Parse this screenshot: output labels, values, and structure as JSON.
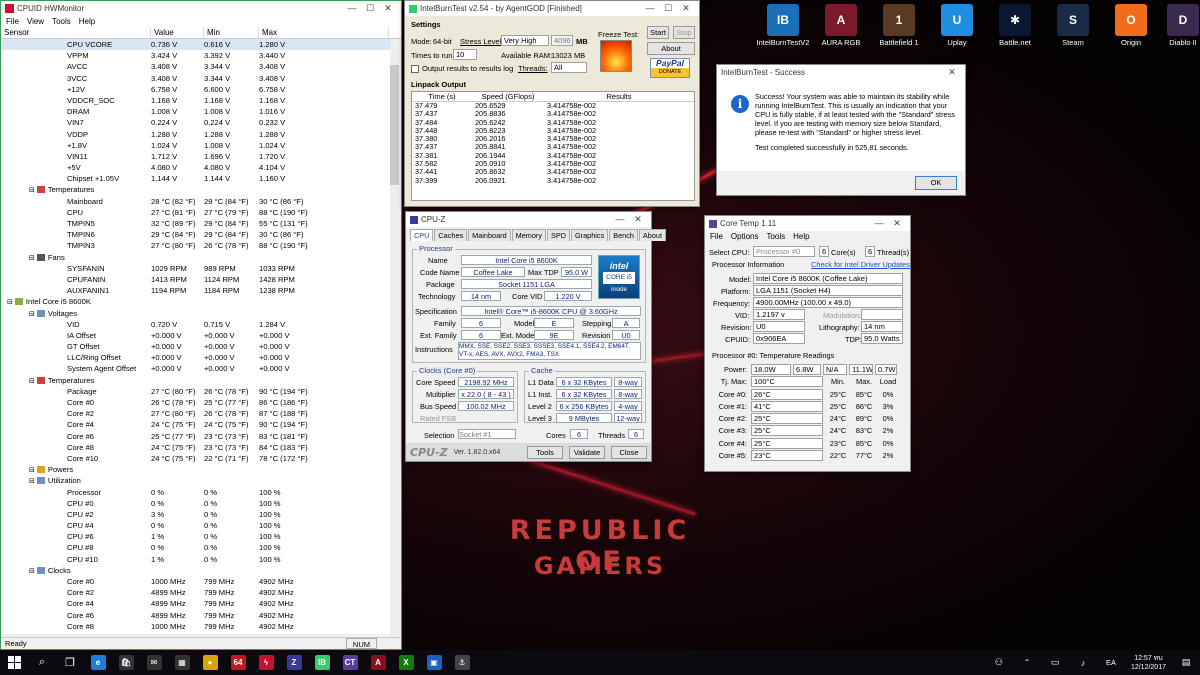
{
  "desktop": {
    "brand_line1": "REPUBLIC OF",
    "brand_line2": "GAMERS",
    "icons": [
      {
        "label": "IntelBurnTestV2",
        "icon": "intelburntest-icon",
        "color": "#1b6fb8",
        "glyph": "IB"
      },
      {
        "label": "AURA RGB",
        "icon": "aura-rgb-icon",
        "color": "#7a1a2a",
        "glyph": "A"
      },
      {
        "label": "Battlefield 1",
        "icon": "battlefield-icon",
        "color": "#5a3a22",
        "glyph": "1"
      },
      {
        "label": "Uplay",
        "icon": "uplay-icon",
        "color": "#1e8fe0",
        "glyph": "U"
      },
      {
        "label": "Battle.net",
        "icon": "battlenet-icon",
        "color": "#0b1730",
        "glyph": "✱"
      },
      {
        "label": "Steam",
        "icon": "steam-icon",
        "color": "#1a2b45",
        "glyph": "S"
      },
      {
        "label": "Origin",
        "icon": "origin-icon",
        "color": "#f26a1b",
        "glyph": "O"
      },
      {
        "label": "Diablo II",
        "icon": "diablo-icon",
        "color": "#3a2a50",
        "glyph": "D"
      }
    ]
  },
  "hwmon": {
    "title": "CPUID HWMonitor",
    "menu": [
      "File",
      "View",
      "Tools",
      "Help"
    ],
    "columns": [
      "Sensor",
      "Value",
      "Min",
      "Max"
    ],
    "status": "Ready",
    "num": "NUM",
    "rows": [
      [
        "CPU VCORE",
        "0.736 V",
        "0.616 V",
        "1.280 V",
        3,
        "volt"
      ],
      [
        "VPPM",
        "3.424 V",
        "3.392 V",
        "3.440 V",
        3,
        "volt"
      ],
      [
        "AVCC",
        "3.408 V",
        "3.344 V",
        "3.408 V",
        3,
        "volt"
      ],
      [
        "3VCC",
        "3.408 V",
        "3.344 V",
        "3.408 V",
        3,
        "volt"
      ],
      [
        "+12V",
        "6.758 V",
        "6.600 V",
        "6.758 V",
        3,
        "volt"
      ],
      [
        "VDDCR_SOC",
        "1.168 V",
        "1.168 V",
        "1.168 V",
        3,
        "volt"
      ],
      [
        "DRAM",
        "1.008 V",
        "1.008 V",
        "1.016 V",
        3,
        "volt"
      ],
      [
        "VIN7",
        "0.224 V",
        "0.224 V",
        "0.232 V",
        3,
        "volt"
      ],
      [
        "VDDP",
        "1.288 V",
        "1.288 V",
        "1.288 V",
        3,
        "volt"
      ],
      [
        "+1.8V",
        "1.024 V",
        "1.008 V",
        "1.024 V",
        3,
        "volt"
      ],
      [
        "VIN11",
        "1.712 V",
        "1.696 V",
        "1.720 V",
        3,
        "volt"
      ],
      [
        "+5V",
        "4.080 V",
        "4.080 V",
        "4.104 V",
        3,
        "volt"
      ],
      [
        "Chipset +1.05V",
        "1.144 V",
        "1.144 V",
        "1.160 V",
        3,
        "volt"
      ],
      [
        "Temperatures",
        "",
        "",
        "",
        2,
        "temp"
      ],
      [
        "Mainboard",
        "28 °C (82 °F)",
        "29 °C (84 °F)",
        "30 °C (86 °F)",
        3,
        ""
      ],
      [
        "CPU",
        "27 °C (81 °F)",
        "27 °C (79 °F)",
        "88 °C (190 °F)",
        3,
        ""
      ],
      [
        "TMPIN5",
        "32 °C (89 °F)",
        "29 °C (84 °F)",
        "55 °C (131 °F)",
        3,
        ""
      ],
      [
        "TMPIN6",
        "29 °C (84 °F)",
        "29 °C (84 °F)",
        "30 °C (86 °F)",
        3,
        ""
      ],
      [
        "TMPIN3",
        "27 °C (80 °F)",
        "26 °C (78 °F)",
        "88 °C (190 °F)",
        3,
        ""
      ],
      [
        "Fans",
        "",
        "",
        "",
        2,
        "fan"
      ],
      [
        "SYSFANIN",
        "1029 RPM",
        "989 RPM",
        "1033 RPM",
        3,
        ""
      ],
      [
        "CPUFANIN",
        "1413 RPM",
        "1124 RPM",
        "1428 RPM",
        3,
        ""
      ],
      [
        "AUXFANIN1",
        "1194 RPM",
        "1184 RPM",
        "1238 RPM",
        3,
        ""
      ],
      [
        "Intel Core i5 8600K",
        "",
        "",
        "",
        1,
        "chip"
      ],
      [
        "Voltages",
        "",
        "",
        "",
        2,
        "volt"
      ],
      [
        "VID",
        "0.720 V",
        "0.715 V",
        "1.284 V",
        3,
        ""
      ],
      [
        "IA Offset",
        "+0.000 V",
        "+0.000 V",
        "+0.000 V",
        3,
        ""
      ],
      [
        "GT Offset",
        "+0.000 V",
        "+0.000 V",
        "+0.000 V",
        3,
        ""
      ],
      [
        "LLC/Ring Offset",
        "+0.000 V",
        "+0.000 V",
        "+0.000 V",
        3,
        ""
      ],
      [
        "System Agent Offset",
        "+0.000 V",
        "+0.000 V",
        "+0.000 V",
        3,
        ""
      ],
      [
        "Temperatures",
        "",
        "",
        "",
        2,
        "temp"
      ],
      [
        "Package",
        "27 °C (80 °F)",
        "26 °C (78 °F)",
        "90 °C (194 °F)",
        3,
        ""
      ],
      [
        "Core #0",
        "26 °C (78 °F)",
        "25 °C (77 °F)",
        "86 °C (186 °F)",
        3,
        ""
      ],
      [
        "Core #2",
        "27 °C (80 °F)",
        "26 °C (78 °F)",
        "87 °C (188 °F)",
        3,
        ""
      ],
      [
        "Core #4",
        "24 °C (75 °F)",
        "24 °C (75 °F)",
        "90 °C (194 °F)",
        3,
        ""
      ],
      [
        "Core #6",
        "25 °C (77 °F)",
        "23 °C (73 °F)",
        "83 °C (181 °F)",
        3,
        ""
      ],
      [
        "Core #8",
        "24 °C (75 °F)",
        "23 °C (73 °F)",
        "84 °C (183 °F)",
        3,
        ""
      ],
      [
        "Core #10",
        "24 °C (75 °F)",
        "22 °C (71 °F)",
        "78 °C (172 °F)",
        3,
        ""
      ],
      [
        "Powers",
        "",
        "",
        "",
        2,
        "power"
      ],
      [
        "Utilization",
        "",
        "",
        "",
        2,
        "util"
      ],
      [
        "Processor",
        "0 %",
        "0 %",
        "100 %",
        3,
        ""
      ],
      [
        "CPU #0",
        "0 %",
        "0 %",
        "100 %",
        3,
        ""
      ],
      [
        "CPU #2",
        "3 %",
        "0 %",
        "100 %",
        3,
        ""
      ],
      [
        "CPU #4",
        "0 %",
        "0 %",
        "100 %",
        3,
        ""
      ],
      [
        "CPU #6",
        "1 %",
        "0 %",
        "100 %",
        3,
        ""
      ],
      [
        "CPU #8",
        "0 %",
        "0 %",
        "100 %",
        3,
        ""
      ],
      [
        "CPU #10",
        "1 %",
        "0 %",
        "100 %",
        3,
        ""
      ],
      [
        "Clocks",
        "",
        "",
        "",
        2,
        "clock"
      ],
      [
        "Core #0",
        "1000 MHz",
        "799 MHz",
        "4902 MHz",
        3,
        ""
      ],
      [
        "Core #2",
        "4899 MHz",
        "799 MHz",
        "4902 MHz",
        3,
        ""
      ],
      [
        "Core #4",
        "4899 MHz",
        "799 MHz",
        "4902 MHz",
        3,
        ""
      ],
      [
        "Core #6",
        "4899 MHz",
        "799 MHz",
        "4902 MHz",
        3,
        ""
      ],
      [
        "Core #8",
        "1000 MHz",
        "799 MHz",
        "4902 MHz",
        3,
        ""
      ]
    ]
  },
  "ibt": {
    "title": "IntelBurnTest v2.54 - by AgentGOD [Finished]",
    "settings": "Settings",
    "mode_label": "Mode:",
    "mode": "64-bit",
    "stress_label": "Stress Level:",
    "stress": "Very High",
    "mem": "4096",
    "mb": "MB",
    "times_label": "Times to run:",
    "times": "10",
    "avail_label": "Available RAM:",
    "avail": "13023 MB",
    "threads_label": "Threads:",
    "threads": "All",
    "log_label": "Output results to results log",
    "freeze": "Freeze Test:",
    "start": "Start",
    "stop": "Stop",
    "about": "About",
    "paypal": "PayPal",
    "donate": "DONATE",
    "output": "Linpack Output",
    "col_time": "Time (s)",
    "col_speed": "Speed (GFlops)",
    "col_results": "Results",
    "results": [
      [
        "37.479",
        "205.6529",
        "3.414758e-002"
      ],
      [
        "37.437",
        "205.8836",
        "3.414758e-002"
      ],
      [
        "37.484",
        "205.6242",
        "3.414758e-002"
      ],
      [
        "37.448",
        "205.8223",
        "3.414758e-002"
      ],
      [
        "37.380",
        "206.2016",
        "3.414758e-002"
      ],
      [
        "37.437",
        "205.8841",
        "3.414758e-002"
      ],
      [
        "37.381",
        "206.1944",
        "3.414758e-002"
      ],
      [
        "37.582",
        "205.0910",
        "3.414758e-002"
      ],
      [
        "37.441",
        "205.8632",
        "3.414758e-002"
      ],
      [
        "37.399",
        "206.0921",
        "3.414758e-002"
      ]
    ]
  },
  "success": {
    "title": "IntelBurnTest - Success",
    "message": "Success! Your system was able to maintain its stability while running IntelBurnTest. This is usually an indication that your CPU is fully stable, if at least tested with the \"Standard\" stress level. If you are testing with memory size below Standard,",
    "message2": "please re-test with \"Standard\" or higher stress level.",
    "message3": "Test completed successfully in 525,81 seconds.",
    "ok": "OK"
  },
  "cpuz": {
    "title": "CPU-Z",
    "tabs": [
      "CPU",
      "Caches",
      "Mainboard",
      "Memory",
      "SPD",
      "Graphics",
      "Bench",
      "About"
    ],
    "processor": "Processor",
    "name_l": "Name",
    "name": "Intel Core i5 8600K",
    "code_l": "Code Name",
    "code": "Coffee Lake",
    "tdp_l": "Max TDP",
    "tdp": "95.0 W",
    "pkg_l": "Package",
    "pkg": "Socket 1151 LGA",
    "tech_l": "Technology",
    "tech": "14 nm",
    "vid_l": "Core VID",
    "vid": "1.220 V",
    "spec_l": "Specification",
    "spec": "Intel® Core™ i5-8600K CPU @ 3.60GHz",
    "fam_l": "Family",
    "fam": "6",
    "model_l": "Model",
    "model": "E",
    "step_l": "Stepping",
    "step": "A",
    "efam_l": "Ext. Family",
    "efam": "6",
    "emod_l": "Ext. Model",
    "emod": "9E",
    "rev_l": "Revision",
    "rev": "U0",
    "inst_l": "Instructions",
    "inst": "MMX, SSE, SSE2, SSE3, SSSE3, SSE4.1, SSE4.2, EM64T, VT-x, AES, AVX, AVX2, FMA3, TSX",
    "clocks": "Clocks (Core #0)",
    "cs_l": "Core Speed",
    "cs": "2198.92 MHz",
    "mul_l": "Multiplier",
    "mul": "x 22.0 ( 8 - 43 )",
    "bus_l": "Bus Speed",
    "bus": "100.02 MHz",
    "fsb_l": "Rated FSB",
    "cache": "Cache",
    "l1d_l": "L1 Data",
    "l1d": "6 x 32 KBytes",
    "l1d_w": "8-way",
    "l1i_l": "L1 Inst.",
    "l1i": "6 x 32 KBytes",
    "l1i_w": "8-way",
    "l2_l": "Level 2",
    "l2": "6 x 256 KBytes",
    "l2_w": "4-way",
    "l3_l": "Level 3",
    "l3": "9 MBytes",
    "l3_w": "12-way",
    "sel_l": "Selection",
    "sel": "Socket #1",
    "cores_l": "Cores",
    "cores": "6",
    "thr_l": "Threads",
    "thr": "6",
    "logo": "CPU-Z",
    "ver": "Ver. 1.82.0.x64",
    "tools": "Tools",
    "validate": "Validate",
    "close": "Close",
    "badge1": "intel",
    "badge2": "CORE i5",
    "badge3": "inside"
  },
  "coretemp": {
    "title": "Core Temp 1.11",
    "menu": [
      "File",
      "Options",
      "Tools",
      "Help"
    ],
    "sel_l": "Select CPU:",
    "sel": "Processor #0",
    "cores": "6",
    "cores_l": "Core(s)",
    "thr": "6",
    "thr_l": "Thread(s)",
    "pi": "Processor Information",
    "link": "Check for Intel Driver Updates",
    "model_l": "Model:",
    "model": "Intel Core i5 8600K (Coffee Lake)",
    "plat_l": "Platform:",
    "plat": "LGA 1151 (Socket H4)",
    "freq_l": "Frequency:",
    "freq": "4900.00MHz (100.00 x 49.0)",
    "vid_l": "VID:",
    "vid": "1.2197 v",
    "mod_l": "Modulation:",
    "rev_l": "Revision:",
    "rev": "U0",
    "lith_l": "Lithography:",
    "lith": "14 nm",
    "cpuid_l": "CPUID:",
    "cpuid": "0x906EA",
    "tdp_l": "TDP:",
    "tdp": "95.0 Watts",
    "tr": "Processor #0: Temperature Readings",
    "power_l": "Power:",
    "p1": "18.0W",
    "p2": "6.8W",
    "p3": "N/A",
    "p4": "11.1W",
    "p5": "0.7W",
    "tj_l": "Tj. Max:",
    "tj": "100°C",
    "min_h": "Min.",
    "max_h": "Max.",
    "load_h": "Load",
    "cores_rows": [
      [
        "Core #0:",
        "26°C",
        "25°C",
        "85°C",
        "0%"
      ],
      [
        "Core #1:",
        "41°C",
        "25°C",
        "86°C",
        "3%"
      ],
      [
        "Core #2:",
        "25°C",
        "24°C",
        "89°C",
        "0%"
      ],
      [
        "Core #3:",
        "25°C",
        "24°C",
        "83°C",
        "2%"
      ],
      [
        "Core #4:",
        "25°C",
        "23°C",
        "85°C",
        "0%"
      ],
      [
        "Core #5:",
        "23°C",
        "22°C",
        "77°C",
        "2%"
      ]
    ]
  },
  "taskbar": {
    "time": "12:57 ทบ",
    "date": "12/12/2017",
    "lang": "EA",
    "apps": [
      {
        "name": "edge-icon",
        "glyph": "e",
        "color": "#1b7fd6"
      },
      {
        "name": "store-icon",
        "glyph": "🛍",
        "color": "#333"
      },
      {
        "name": "mail-icon",
        "glyph": "✉",
        "color": "#333"
      },
      {
        "name": "calculator-icon",
        "glyph": "▦",
        "color": "#333"
      },
      {
        "name": "chrome-icon",
        "glyph": "●",
        "color": "#d9a400"
      },
      {
        "name": "aida64-icon",
        "glyph": "64",
        "color": "#c4161c"
      },
      {
        "name": "hwmonitor-icon",
        "glyph": "ϟ",
        "color": "#c8102e"
      },
      {
        "name": "cpuz-icon",
        "glyph": "Z",
        "color": "#3a3a9a"
      },
      {
        "name": "intelburntest-task-icon",
        "glyph": "IB",
        "color": "#3c6"
      },
      {
        "name": "coretemp-task-icon",
        "glyph": "CT",
        "color": "#5b3fa0"
      },
      {
        "name": "aura-task-icon",
        "glyph": "A",
        "color": "#8a1020"
      },
      {
        "name": "xbox-icon",
        "glyph": "X",
        "color": "#107c10"
      },
      {
        "name": "screen-icon",
        "glyph": "▣",
        "color": "#1565c0"
      },
      {
        "name": "corsair-icon",
        "glyph": "⚓",
        "color": "#444"
      }
    ]
  }
}
